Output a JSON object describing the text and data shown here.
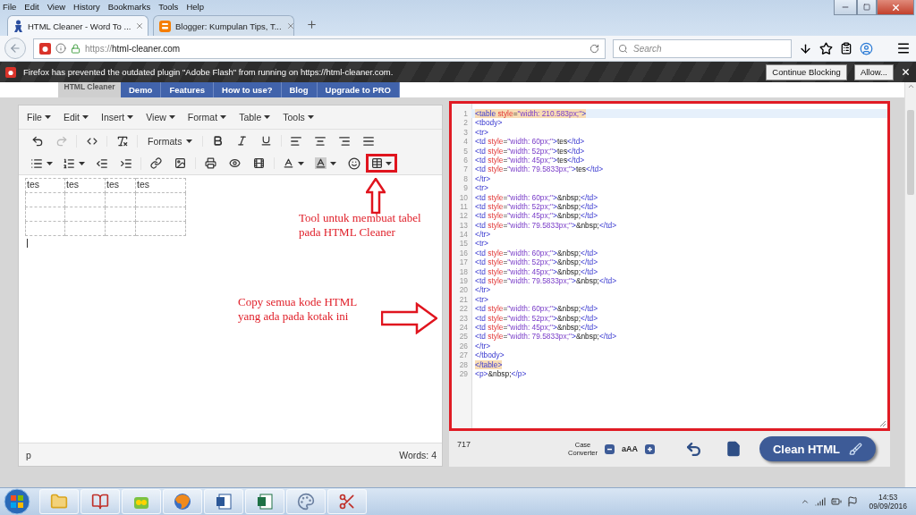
{
  "menu_bar": [
    "File",
    "Edit",
    "View",
    "History",
    "Bookmarks",
    "Tools",
    "Help"
  ],
  "tabs": [
    {
      "title": "HTML Cleaner - Word To ...",
      "selected": true
    },
    {
      "title": "Blogger: Kumpulan Tips, T...",
      "selected": false
    }
  ],
  "address": {
    "url_prefix": "https://",
    "url_host": "html-cleaner.com"
  },
  "search": {
    "placeholder": "Search"
  },
  "notification": {
    "message": "Firefox has prevented the outdated plugin \"Adobe Flash\" from running on https://html-cleaner.com.",
    "buttons": [
      "Continue Blocking",
      "Allow..."
    ]
  },
  "site_nav": {
    "logo": "HTML Cleaner",
    "items": [
      "Demo",
      "Features",
      "How to use?",
      "Blog",
      "Upgrade to PRO"
    ]
  },
  "editor": {
    "menus": [
      "File",
      "Edit",
      "Insert",
      "View",
      "Format",
      "Table",
      "Tools"
    ],
    "formats_label": "Formats",
    "table": {
      "rows": [
        {
          "blank": false,
          "cells": [
            "tes",
            "tes",
            "tes",
            "tes"
          ]
        },
        {
          "blank": true
        },
        {
          "blank": true
        },
        {
          "blank": true
        }
      ]
    },
    "status_path": "p",
    "word_count": "Words: 4"
  },
  "annotations": [
    {
      "kind": "up",
      "text": "Tool untuk membuat tabel\npada HTML Cleaner"
    },
    {
      "kind": "right",
      "text": "Copy semua kode HTML\nyang ada pada kotak ini"
    }
  ],
  "code_lines": [
    {
      "no": "1",
      "active": true,
      "match": true,
      "segments": [
        {
          "kind": "tag",
          "text": "<table"
        },
        {
          "kind": "attr",
          "text": " style"
        },
        {
          "kind": "plain",
          "text": "="
        },
        {
          "kind": "string",
          "text": "\"width: 210.583px;\""
        },
        {
          "kind": "tag",
          "text": ">"
        }
      ]
    },
    {
      "no": "2",
      "active": false,
      "match": false,
      "segments": [
        {
          "kind": "tag",
          "text": "<tbody>"
        }
      ]
    },
    {
      "no": "3",
      "active": false,
      "match": false,
      "segments": [
        {
          "kind": "tag",
          "text": "<tr>"
        }
      ]
    },
    {
      "no": "4",
      "active": false,
      "match": false,
      "segments": [
        {
          "kind": "tag",
          "text": "<td"
        },
        {
          "kind": "attr",
          "text": " style"
        },
        {
          "kind": "plain",
          "text": "="
        },
        {
          "kind": "string",
          "text": "\"width: 60px;\""
        },
        {
          "kind": "tag",
          "text": ">"
        },
        {
          "kind": "plain",
          "text": "tes"
        },
        {
          "kind": "tag",
          "text": "</td>"
        }
      ]
    },
    {
      "no": "5",
      "active": false,
      "match": false,
      "segments": [
        {
          "kind": "tag",
          "text": "<td"
        },
        {
          "kind": "attr",
          "text": " style"
        },
        {
          "kind": "plain",
          "text": "="
        },
        {
          "kind": "string",
          "text": "\"width: 52px;\""
        },
        {
          "kind": "tag",
          "text": ">"
        },
        {
          "kind": "plain",
          "text": "tes"
        },
        {
          "kind": "tag",
          "text": "</td>"
        }
      ]
    },
    {
      "no": "6",
      "active": false,
      "match": false,
      "segments": [
        {
          "kind": "tag",
          "text": "<td"
        },
        {
          "kind": "attr",
          "text": " style"
        },
        {
          "kind": "plain",
          "text": "="
        },
        {
          "kind": "string",
          "text": "\"width: 45px;\""
        },
        {
          "kind": "tag",
          "text": ">"
        },
        {
          "kind": "plain",
          "text": "tes"
        },
        {
          "kind": "tag",
          "text": "</td>"
        }
      ]
    },
    {
      "no": "7",
      "active": false,
      "match": false,
      "segments": [
        {
          "kind": "tag",
          "text": "<td"
        },
        {
          "kind": "attr",
          "text": " style"
        },
        {
          "kind": "plain",
          "text": "="
        },
        {
          "kind": "string",
          "text": "\"width: 79.5833px;\""
        },
        {
          "kind": "tag",
          "text": ">"
        },
        {
          "kind": "plain",
          "text": "tes"
        },
        {
          "kind": "tag",
          "text": "</td>"
        }
      ]
    },
    {
      "no": "8",
      "active": false,
      "match": false,
      "segments": [
        {
          "kind": "tag",
          "text": "</tr>"
        }
      ]
    },
    {
      "no": "9",
      "active": false,
      "match": false,
      "segments": [
        {
          "kind": "tag",
          "text": "<tr>"
        }
      ]
    },
    {
      "no": "10",
      "active": false,
      "match": false,
      "segments": [
        {
          "kind": "tag",
          "text": "<td"
        },
        {
          "kind": "attr",
          "text": " style"
        },
        {
          "kind": "plain",
          "text": "="
        },
        {
          "kind": "string",
          "text": "\"width: 60px;\""
        },
        {
          "kind": "tag",
          "text": ">"
        },
        {
          "kind": "plain",
          "text": "&nbsp;"
        },
        {
          "kind": "tag",
          "text": "</td>"
        }
      ]
    },
    {
      "no": "11",
      "active": false,
      "match": false,
      "segments": [
        {
          "kind": "tag",
          "text": "<td"
        },
        {
          "kind": "attr",
          "text": " style"
        },
        {
          "kind": "plain",
          "text": "="
        },
        {
          "kind": "string",
          "text": "\"width: 52px;\""
        },
        {
          "kind": "tag",
          "text": ">"
        },
        {
          "kind": "plain",
          "text": "&nbsp;"
        },
        {
          "kind": "tag",
          "text": "</td>"
        }
      ]
    },
    {
      "no": "12",
      "active": false,
      "match": false,
      "segments": [
        {
          "kind": "tag",
          "text": "<td"
        },
        {
          "kind": "attr",
          "text": " style"
        },
        {
          "kind": "plain",
          "text": "="
        },
        {
          "kind": "string",
          "text": "\"width: 45px;\""
        },
        {
          "kind": "tag",
          "text": ">"
        },
        {
          "kind": "plain",
          "text": "&nbsp;"
        },
        {
          "kind": "tag",
          "text": "</td>"
        }
      ]
    },
    {
      "no": "13",
      "active": false,
      "match": false,
      "segments": [
        {
          "kind": "tag",
          "text": "<td"
        },
        {
          "kind": "attr",
          "text": " style"
        },
        {
          "kind": "plain",
          "text": "="
        },
        {
          "kind": "string",
          "text": "\"width: 79.5833px;\""
        },
        {
          "kind": "tag",
          "text": ">"
        },
        {
          "kind": "plain",
          "text": "&nbsp;"
        },
        {
          "kind": "tag",
          "text": "</td>"
        }
      ]
    },
    {
      "no": "14",
      "active": false,
      "match": false,
      "segments": [
        {
          "kind": "tag",
          "text": "</tr>"
        }
      ]
    },
    {
      "no": "15",
      "active": false,
      "match": false,
      "segments": [
        {
          "kind": "tag",
          "text": "<tr>"
        }
      ]
    },
    {
      "no": "16",
      "active": false,
      "match": false,
      "segments": [
        {
          "kind": "tag",
          "text": "<td"
        },
        {
          "kind": "attr",
          "text": " style"
        },
        {
          "kind": "plain",
          "text": "="
        },
        {
          "kind": "string",
          "text": "\"width: 60px;\""
        },
        {
          "kind": "tag",
          "text": ">"
        },
        {
          "kind": "plain",
          "text": "&nbsp;"
        },
        {
          "kind": "tag",
          "text": "</td>"
        }
      ]
    },
    {
      "no": "17",
      "active": false,
      "match": false,
      "segments": [
        {
          "kind": "tag",
          "text": "<td"
        },
        {
          "kind": "attr",
          "text": " style"
        },
        {
          "kind": "plain",
          "text": "="
        },
        {
          "kind": "string",
          "text": "\"width: 52px;\""
        },
        {
          "kind": "tag",
          "text": ">"
        },
        {
          "kind": "plain",
          "text": "&nbsp;"
        },
        {
          "kind": "tag",
          "text": "</td>"
        }
      ]
    },
    {
      "no": "18",
      "active": false,
      "match": false,
      "segments": [
        {
          "kind": "tag",
          "text": "<td"
        },
        {
          "kind": "attr",
          "text": " style"
        },
        {
          "kind": "plain",
          "text": "="
        },
        {
          "kind": "string",
          "text": "\"width: 45px;\""
        },
        {
          "kind": "tag",
          "text": ">"
        },
        {
          "kind": "plain",
          "text": "&nbsp;"
        },
        {
          "kind": "tag",
          "text": "</td>"
        }
      ]
    },
    {
      "no": "19",
      "active": false,
      "match": false,
      "segments": [
        {
          "kind": "tag",
          "text": "<td"
        },
        {
          "kind": "attr",
          "text": " style"
        },
        {
          "kind": "plain",
          "text": "="
        },
        {
          "kind": "string",
          "text": "\"width: 79.5833px;\""
        },
        {
          "kind": "tag",
          "text": ">"
        },
        {
          "kind": "plain",
          "text": "&nbsp;"
        },
        {
          "kind": "tag",
          "text": "</td>"
        }
      ]
    },
    {
      "no": "20",
      "active": false,
      "match": false,
      "segments": [
        {
          "kind": "tag",
          "text": "</tr>"
        }
      ]
    },
    {
      "no": "21",
      "active": false,
      "match": false,
      "segments": [
        {
          "kind": "tag",
          "text": "<tr>"
        }
      ]
    },
    {
      "no": "22",
      "active": false,
      "match": false,
      "segments": [
        {
          "kind": "tag",
          "text": "<td"
        },
        {
          "kind": "attr",
          "text": " style"
        },
        {
          "kind": "plain",
          "text": "="
        },
        {
          "kind": "string",
          "text": "\"width: 60px;\""
        },
        {
          "kind": "tag",
          "text": ">"
        },
        {
          "kind": "plain",
          "text": "&nbsp;"
        },
        {
          "kind": "tag",
          "text": "</td>"
        }
      ]
    },
    {
      "no": "23",
      "active": false,
      "match": false,
      "segments": [
        {
          "kind": "tag",
          "text": "<td"
        },
        {
          "kind": "attr",
          "text": " style"
        },
        {
          "kind": "plain",
          "text": "="
        },
        {
          "kind": "string",
          "text": "\"width: 52px;\""
        },
        {
          "kind": "tag",
          "text": ">"
        },
        {
          "kind": "plain",
          "text": "&nbsp;"
        },
        {
          "kind": "tag",
          "text": "</td>"
        }
      ]
    },
    {
      "no": "24",
      "active": false,
      "match": false,
      "segments": [
        {
          "kind": "tag",
          "text": "<td"
        },
        {
          "kind": "attr",
          "text": " style"
        },
        {
          "kind": "plain",
          "text": "="
        },
        {
          "kind": "string",
          "text": "\"width: 45px;\""
        },
        {
          "kind": "tag",
          "text": ">"
        },
        {
          "kind": "plain",
          "text": "&nbsp;"
        },
        {
          "kind": "tag",
          "text": "</td>"
        }
      ]
    },
    {
      "no": "25",
      "active": false,
      "match": false,
      "segments": [
        {
          "kind": "tag",
          "text": "<td"
        },
        {
          "kind": "attr",
          "text": " style"
        },
        {
          "kind": "plain",
          "text": "="
        },
        {
          "kind": "string",
          "text": "\"width: 79.5833px;\""
        },
        {
          "kind": "tag",
          "text": ">"
        },
        {
          "kind": "plain",
          "text": "&nbsp;"
        },
        {
          "kind": "tag",
          "text": "</td>"
        }
      ]
    },
    {
      "no": "26",
      "active": false,
      "match": false,
      "segments": [
        {
          "kind": "tag",
          "text": "</tr>"
        }
      ]
    },
    {
      "no": "27",
      "active": false,
      "match": false,
      "segments": [
        {
          "kind": "tag",
          "text": "</tbody>"
        }
      ]
    },
    {
      "no": "28",
      "active": false,
      "match": true,
      "segments": [
        {
          "kind": "tag",
          "text": "</table>"
        }
      ]
    },
    {
      "no": "29",
      "active": false,
      "match": false,
      "segments": [
        {
          "kind": "tag",
          "text": "<p>"
        },
        {
          "kind": "plain",
          "text": "&nbsp;"
        },
        {
          "kind": "tag",
          "text": "</p>"
        }
      ]
    }
  ],
  "cleaner_footer": {
    "char_count": "717",
    "case_converter": "Case\nConverter",
    "case_sample": "aAA",
    "clean_button": "Clean HTML"
  },
  "taskbar": {
    "time": "14:53",
    "date": "09/09/2016"
  }
}
